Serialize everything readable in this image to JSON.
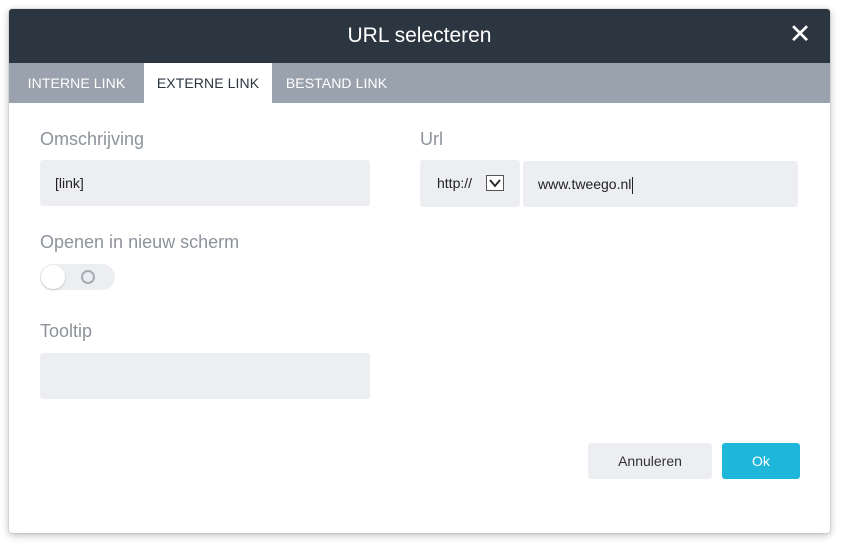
{
  "dialog": {
    "title": "URL selecteren",
    "close_icon": "close-icon"
  },
  "tabs": [
    {
      "label": "INTERNE LINK",
      "active": false
    },
    {
      "label": "EXTERNE LINK",
      "active": true
    },
    {
      "label": "BESTAND LINK",
      "active": false
    }
  ],
  "form": {
    "description": {
      "label": "Omschrijving",
      "value": "[link]"
    },
    "new_window": {
      "label": "Openen in nieuw scherm",
      "enabled": false
    },
    "tooltip": {
      "label": "Tooltip",
      "value": ""
    },
    "url": {
      "label": "Url",
      "protocol": "http://",
      "dropdown_icon": "chevron-down-icon",
      "value": "www.tweego.nl"
    }
  },
  "buttons": {
    "cancel": "Annuleren",
    "ok": "Ok"
  },
  "colors": {
    "header_bg": "#2c3640",
    "tabs_bg": "#9aa2ad",
    "field_bg": "#eceef1",
    "label": "#8d939b",
    "primary": "#1eb6d9"
  }
}
